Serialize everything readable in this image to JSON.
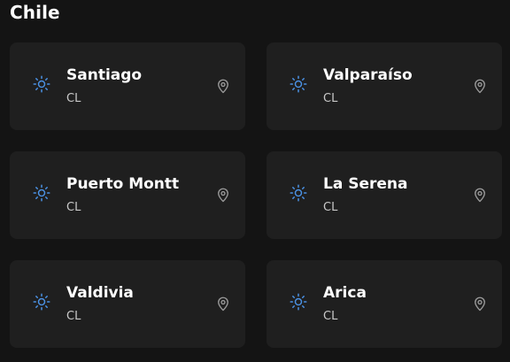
{
  "header": {
    "title": "Chile"
  },
  "cities": [
    {
      "name": "Santiago",
      "country": "CL"
    },
    {
      "name": "Valparaíso",
      "country": "CL"
    },
    {
      "name": "Puerto Montt",
      "country": "CL"
    },
    {
      "name": "La Serena",
      "country": "CL"
    },
    {
      "name": "Valdivia",
      "country": "CL"
    },
    {
      "name": "Arica",
      "country": "CL"
    }
  ],
  "icons": {
    "weather": "sun-icon",
    "location": "map-pin-icon"
  },
  "colors": {
    "accent": "#4a90e2",
    "card": "#1f1f1f",
    "background": "#141414"
  }
}
